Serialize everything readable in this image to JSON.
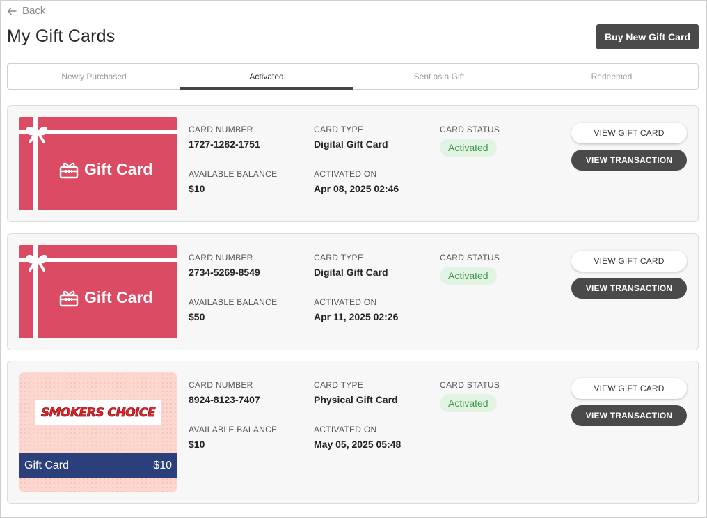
{
  "header": {
    "back_label": "Back",
    "title": "My Gift Cards",
    "buy_label": "Buy New Gift Card"
  },
  "tabs": [
    {
      "label": "Newly Purchased",
      "active": false
    },
    {
      "label": "Activated",
      "active": true
    },
    {
      "label": "Sent as a Gift",
      "active": false
    },
    {
      "label": "Redeemed",
      "active": false
    }
  ],
  "labels": {
    "card_number": "CARD NUMBER",
    "card_type": "CARD TYPE",
    "card_status": "CARD STATUS",
    "available_balance": "AVAILABLE BALANCE",
    "activated_on": "ACTIVATED ON",
    "view_gift_card": "VIEW GIFT CARD",
    "view_transaction": "VIEW TRANSACTION"
  },
  "cards": [
    {
      "image_style": "digital",
      "image_label": "Gift Card",
      "number": "1727-1282-1751",
      "type": "Digital Gift Card",
      "status": "Activated",
      "balance": "$10",
      "activated_on": "Apr 08, 2025 02:46"
    },
    {
      "image_style": "digital",
      "image_label": "Gift Card",
      "number": "2734-5269-8549",
      "type": "Digital Gift Card",
      "status": "Activated",
      "balance": "$50",
      "activated_on": "Apr 11, 2025 02:26"
    },
    {
      "image_style": "physical",
      "brand_logo_text": "SMOKERS CHOICE",
      "image_label": "Gift Card",
      "image_value": "$10",
      "number": "8924-8123-7407",
      "type": "Physical Gift Card",
      "status": "Activated",
      "balance": "$10",
      "activated_on": "May 05, 2025 05:48"
    }
  ],
  "colors": {
    "digital_card": "#dc4b64",
    "physical_card_bg": "#fcd7cf",
    "physical_card_bar": "#2b3f7a",
    "status_badge_bg": "#e3f3e3",
    "status_badge_text": "#3f9a4d",
    "dark_button": "#4a4a4a"
  }
}
